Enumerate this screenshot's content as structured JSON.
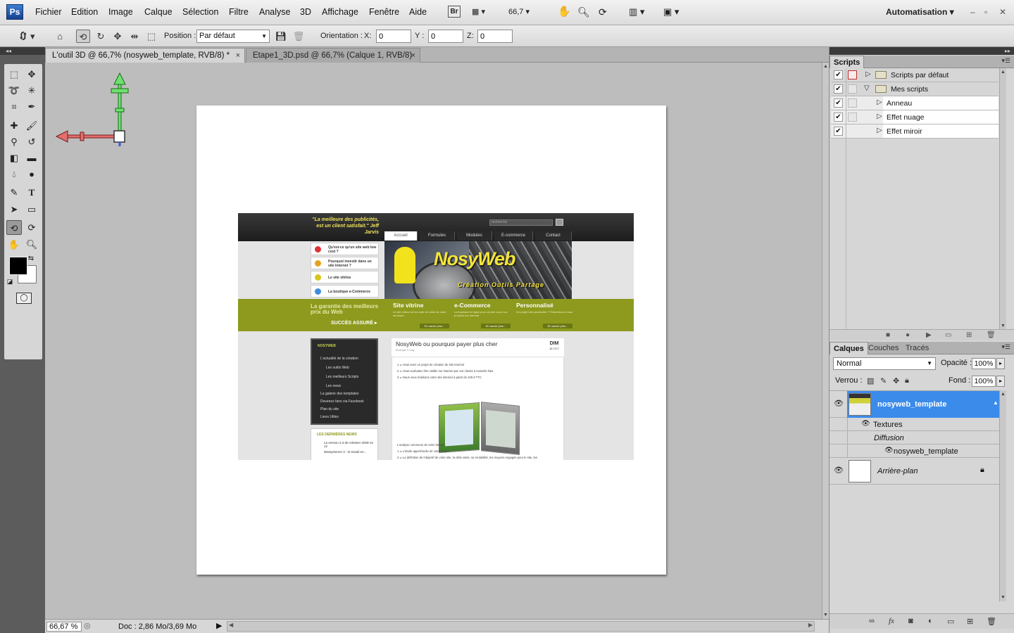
{
  "app": {
    "logo": "Ps"
  },
  "menu": [
    "Fichier",
    "Edition",
    "Image",
    "Calque",
    "Sélection",
    "Filtre",
    "Analyse",
    "3D",
    "Affichage",
    "Fenêtre",
    "Aide"
  ],
  "menubar": {
    "bridge": "Br",
    "zoom": "66,7",
    "workspace": "Automatisation"
  },
  "options": {
    "position_label": "Position :",
    "position_value": "Par défaut",
    "orientation_label": "Orientation :",
    "x_label": "X:",
    "x_value": "0",
    "y_label": "Y :",
    "y_value": "0",
    "z_label": "Z:",
    "z_value": "0"
  },
  "tabs": [
    {
      "label": "L'outil 3D @ 66,7% (nosyweb_template, RVB/8) *",
      "close": "×"
    },
    {
      "label": "Etape1_3D.psd @ 66,7% (Calque 1, RVB/8)",
      "close": "×"
    }
  ],
  "status": {
    "zoom": "66,67 %",
    "doc": "Doc : 2,86 Mo/3,69 Mo"
  },
  "site": {
    "quote": "\"La meilleure des publicités, est un client satisfait.\" Jeff Jarvis",
    "search_placeholder": "recherche",
    "nav": [
      "Accueil",
      "Formules",
      "Modules",
      "E-commerce",
      "Contact"
    ],
    "leftnav": [
      "Qu'est-ce qu'un site web low cost ?",
      "Pourquoi investir dans un site Internet ?",
      "Le site vitrine",
      "La boutique e-Commerce"
    ],
    "banner_title": "NosyWeb",
    "banner_sub": "Création  Outils  Partage",
    "guarantee": "La garantie des meilleurs prix du Web",
    "guarantee_cta": "SUCCÈS ASSURÉ ▸",
    "columns": [
      {
        "title": "Site vitrine",
        "text": "Le site vitrine est la carte de visite de votre structure.",
        "btn": "En savoir plus..."
      },
      {
        "title": "e-Commerce",
        "text": "La boutique en ligne pour vendre avec vos produits sur internet",
        "btn": "En savoir plus..."
      },
      {
        "title": "Personnalisé",
        "text": "Un projet bien particulier ? Présentez-le nous",
        "btn": "En savoir plus..."
      }
    ],
    "menu_title": "NOSYWEB",
    "menu_items": [
      "L'actualité de la création",
      "Les outils Web",
      "Les meilleurs Scripts",
      "Les news",
      "La galerie des templates",
      "Devenez fans via Facebook",
      "Plan du site",
      "Liens Utiles"
    ],
    "news_title": "LES DERNIÈRES NEWS",
    "news_item": "La version 2.3 de Artisteer  2009-11-12",
    "news_item2": "WampServer 2 : le travail en...",
    "article_title": "NosyWeb ou pourquoi payer plus cher",
    "article_byline": "Ecrit par C-Jay",
    "article_day": "DIM",
    "article_date": "18 OCT",
    "article_points": [
      "Vous avez un projet de création de site internet",
      "Vous souhaitez être visible sur internet par vos clients à moindre frais",
      "Nous vous réalisons votre site internet à partir de 249 € TTC"
    ],
    "article_lower": [
      "L'analyse commune de votre besoin :",
      "L'étude approfondie de votre projet",
      "La définition de l'objectif de votre site, la cible visée, sa rentabilité, les moyens engagés pour le site, les"
    ]
  },
  "scripts_panel": {
    "tab": "Scripts",
    "rows": [
      {
        "label": "Scripts par défaut",
        "kind": "folder"
      },
      {
        "label": "Mes scripts",
        "kind": "folder"
      },
      {
        "label": "Anneau",
        "kind": "action"
      },
      {
        "label": "Effet nuage",
        "kind": "action"
      },
      {
        "label": "Effet miroir",
        "kind": "action"
      }
    ]
  },
  "layers_panel": {
    "tabs": [
      "Calques",
      "Couches",
      "Tracés"
    ],
    "blend_mode": "Normal",
    "opacity_label": "Opacité :",
    "opacity": "100%",
    "lock_label": "Verrou :",
    "fill_label": "Fond :",
    "fill": "100%",
    "layers": [
      {
        "name": "nosyweb_template"
      },
      {
        "name": "Textures"
      },
      {
        "name": "Diffusion"
      },
      {
        "name": "nosyweb_template"
      },
      {
        "name": "Arrière-plan"
      }
    ]
  },
  "colors": {
    "selection": "#3b8bea",
    "site_green": "#8d9a1e",
    "banner_yellow": "#f5e53a"
  }
}
